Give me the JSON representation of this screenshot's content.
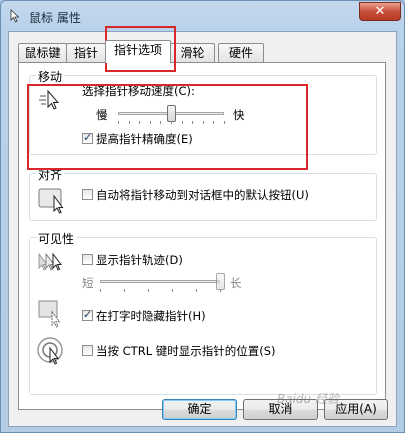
{
  "window": {
    "title": "鼠标 属性",
    "close_glyph": "✕"
  },
  "tabs": [
    {
      "label": "鼠标键"
    },
    {
      "label": "指针"
    },
    {
      "label": "指针选项",
      "active": true
    },
    {
      "label": "滑轮"
    },
    {
      "label": "硬件"
    }
  ],
  "motion": {
    "group_title": "移动",
    "speed_label": "选择指针移动速度(C):",
    "slow_label": "慢",
    "fast_label": "快",
    "speed_fraction": 0.5,
    "precision_label": "提高指针精确度(E)",
    "precision_checked": true
  },
  "snap": {
    "group_title": "对齐",
    "label": "自动将指针移动到对话框中的默认按钮(U)",
    "checked": false
  },
  "visibility": {
    "group_title": "可见性",
    "trails_label": "显示指针轨迹(D)",
    "trails_checked": false,
    "short_label": "短",
    "long_label": "长",
    "trail_fraction": 1.0,
    "hide_typing_label": "在打字时隐藏指针(H)",
    "hide_typing_checked": true,
    "ctrl_label": "当按 CTRL 键时显示指针的位置(S)",
    "ctrl_checked": false
  },
  "buttons": {
    "ok": "确定",
    "cancel": "取消",
    "apply": "应用(A)"
  },
  "watermark": "Baidu 经验"
}
